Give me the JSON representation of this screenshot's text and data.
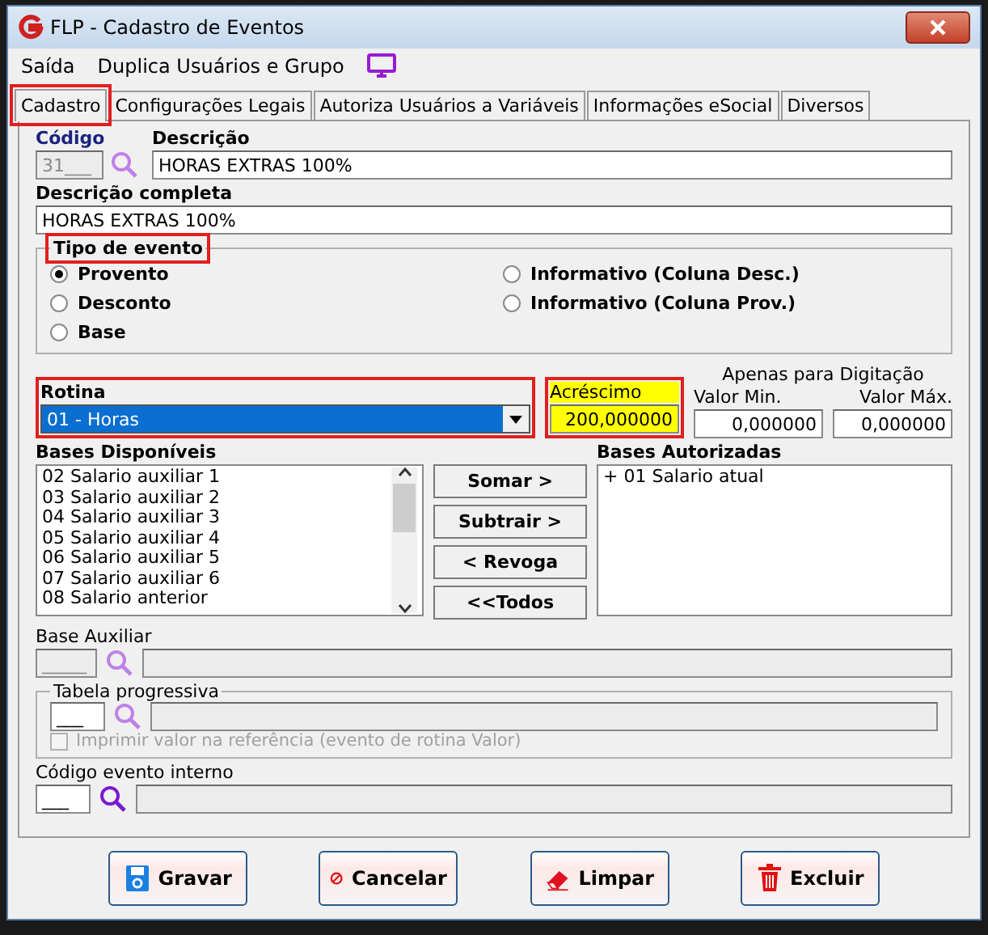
{
  "window": {
    "title": "FLP - Cadastro de Eventos"
  },
  "menu": [
    {
      "label": "Saída"
    },
    {
      "label": "Duplica Usuários e Grupo"
    }
  ],
  "tabs": [
    {
      "label": "Cadastro",
      "selected": true,
      "highlighted": true
    },
    {
      "label": "Configurações Legais",
      "selected": false,
      "highlighted": false
    },
    {
      "label": "Autoriza Usuários a Variáveis",
      "selected": false,
      "highlighted": false
    },
    {
      "label": "Informações eSocial",
      "selected": false,
      "highlighted": false
    },
    {
      "label": "Diversos",
      "selected": false,
      "highlighted": false
    }
  ],
  "codigo": {
    "label": "Código",
    "value": "31___"
  },
  "descricao": {
    "label": "Descrição",
    "value": "HORAS EXTRAS 100%"
  },
  "descricao_completa": {
    "label": "Descrição completa",
    "value": "HORAS EXTRAS 100%"
  },
  "tipo_evento": {
    "title": "Tipo de evento",
    "highlighted": true,
    "options": [
      {
        "label": "Provento",
        "selected": true
      },
      {
        "label": "Desconto",
        "selected": false
      },
      {
        "label": "Base",
        "selected": false
      },
      {
        "label": "Informativo (Coluna Desc.)",
        "selected": false
      },
      {
        "label": "Informativo (Coluna Prov.)",
        "selected": false
      }
    ]
  },
  "rotina": {
    "label": "Rotina",
    "value": "01 - Horas",
    "highlighted": true
  },
  "acrescimo": {
    "label": "Acréscimo",
    "value": "200,000000",
    "highlighted": true
  },
  "digitacao": {
    "caption": "Apenas para Digitação",
    "min_label": "Valor Min.",
    "min_value": "0,000000",
    "max_label": "Valor Máx.",
    "max_value": "0,000000"
  },
  "bases_disponiveis": {
    "label": "Bases Disponíveis",
    "items": [
      "02 Salario auxiliar 1",
      "03 Salario auxiliar 2",
      "04 Salario auxiliar 3",
      "05 Salario auxiliar 4",
      "06 Salario auxiliar 5",
      "07 Salario auxiliar 6",
      "08 Salario anterior"
    ]
  },
  "transfer_buttons": [
    "Somar >",
    "Subtrair >",
    "< Revoga",
    "<<Todos"
  ],
  "bases_autorizadas": {
    "label": "Bases Autorizadas",
    "items": [
      "+ 01 Salario atual"
    ]
  },
  "base_auxiliar": {
    "label": "Base Auxiliar",
    "code": "_____"
  },
  "tabela_progressiva": {
    "title": "Tabela progressiva",
    "code": "___",
    "checkbox_label": "Imprimir valor na referência (evento de rotina Valor)",
    "checked": false,
    "disabled": true
  },
  "codigo_evento_interno": {
    "label": "Código evento interno",
    "code": "___"
  },
  "buttons": [
    {
      "label": "Gravar",
      "kind": "save"
    },
    {
      "label": "Cancelar",
      "kind": "cancel"
    },
    {
      "label": "Limpar",
      "kind": "clear"
    },
    {
      "label": "Excluir",
      "kind": "delete"
    }
  ]
}
